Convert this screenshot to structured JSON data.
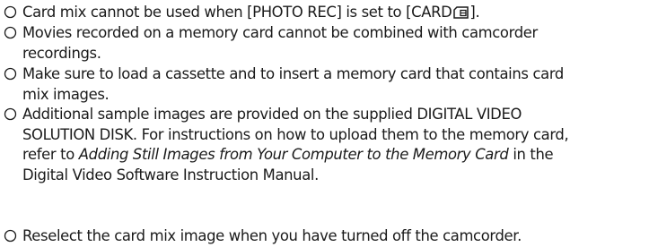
{
  "notes": [
    {
      "pre": "Card mix cannot be used when [PHOTO REC] is set to [CARD",
      "icon": "card-icon",
      "post": "]."
    },
    {
      "line1": "Movies recorded on a memory card cannot be combined with camcorder",
      "line2": "recordings."
    },
    {
      "line1": "Make sure to load a cassette and to insert a memory card that contains card",
      "line2": "mix images."
    },
    {
      "line1": "Additional sample images are provided on the supplied DIGITAL VIDEO",
      "line2": "SOLUTION DISK. For instructions on how to upload them to the memory card,",
      "line3_pre": "refer to ",
      "line3_em": "Adding Still Images from Your Computer to the Memory Card",
      "line3_post": " in the",
      "line4": "Digital Video Software Instruction Manual."
    },
    {
      "line1": "Reselect the card mix image when you have turned off the camcorder."
    }
  ]
}
